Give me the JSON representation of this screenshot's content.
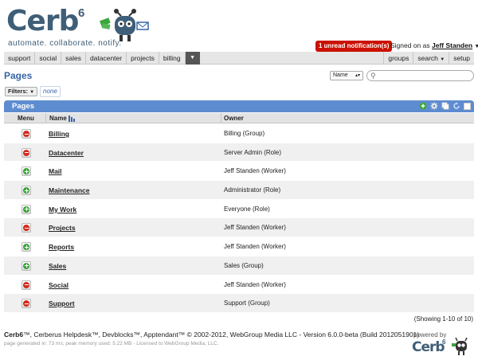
{
  "header": {
    "logo_text": "Cerb",
    "logo_sup": "6",
    "tagline": "automate. collaborate. notify.",
    "notification": "1 unread notification(s)",
    "signed_prefix": "Signed on as",
    "user_name": "Jeff Standen"
  },
  "nav": {
    "left": [
      "support",
      "social",
      "sales",
      "datacenter",
      "projects",
      "billing"
    ],
    "right": [
      "groups",
      "search",
      "setup"
    ]
  },
  "page": {
    "title": "Pages",
    "sort_value": "Name",
    "search_value": ""
  },
  "filters": {
    "label": "Filters:",
    "value": "none"
  },
  "worklist": {
    "title": "Pages",
    "columns": {
      "menu": "Menu",
      "name": "Name",
      "owner": "Owner"
    },
    "rows": [
      {
        "name": "Billing",
        "owner": "Billing (Group)",
        "status": "remove"
      },
      {
        "name": "Datacenter",
        "owner": "Server Admin (Role)",
        "status": "remove"
      },
      {
        "name": "Mail",
        "owner": "Jeff Standen (Worker)",
        "status": "add"
      },
      {
        "name": "Maintenance",
        "owner": "Administrator (Role)",
        "status": "add"
      },
      {
        "name": "My Work",
        "owner": "Everyone (Role)",
        "status": "add"
      },
      {
        "name": "Projects",
        "owner": "Jeff Standen (Worker)",
        "status": "remove"
      },
      {
        "name": "Reports",
        "owner": "Jeff Standen (Worker)",
        "status": "add"
      },
      {
        "name": "Sales",
        "owner": "Sales (Group)",
        "status": "add"
      },
      {
        "name": "Social",
        "owner": "Jeff Standen (Worker)",
        "status": "remove"
      },
      {
        "name": "Support",
        "owner": "Support (Group)",
        "status": "remove"
      }
    ],
    "showing": "(Showing 1-10 of 10)"
  },
  "footer": {
    "main": "™, Cerberus Helpdesk™, Devblocks™, Apptendant™ © 2002-2012, WebGroup Media LLC - Version 6.0.0-beta (Build 2012051901)",
    "brand": "Cerb6",
    "sub": "page generated in: 73 ms; peak memory used: 5.22 MB - Licensed to WebGroup Media, LLC.",
    "powered_by": "powered by",
    "powered_logo": "Cerb",
    "powered_sup": "6"
  },
  "colors": {
    "brand": "#3f5e77",
    "accent": "#5e8cd0",
    "alert": "#cc1100",
    "remove": "#d42b1e",
    "add": "#3aa63a"
  }
}
